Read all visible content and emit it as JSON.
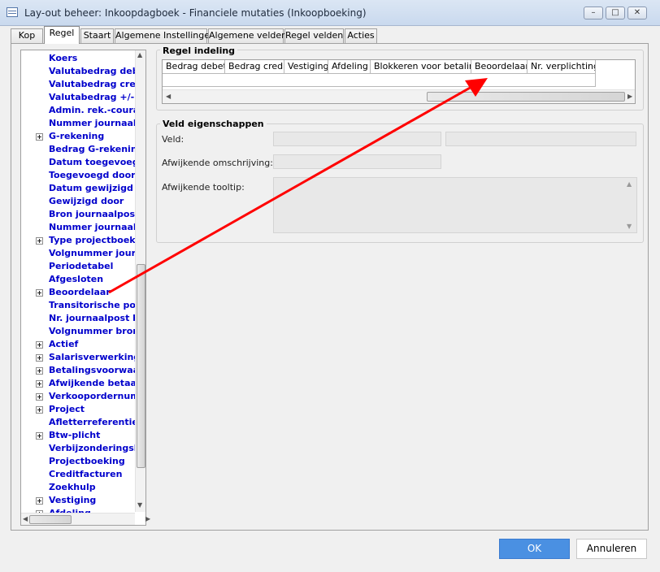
{
  "window": {
    "title": "Lay-out beheer: Inkoopdagboek - Financiele mutaties (Inkoopboeking)"
  },
  "tabs": [
    "Kop",
    "Regel",
    "Staart",
    "Algemene Instellingen",
    "Algemene velden",
    "Regel velden",
    "Acties"
  ],
  "active_tab": "Regel",
  "tree": {
    "items": [
      {
        "label": "Koers",
        "expandable": false
      },
      {
        "label": "Valutabedrag debe",
        "expandable": false
      },
      {
        "label": "Valutabedrag cred",
        "expandable": false
      },
      {
        "label": "Valutabedrag +/-",
        "expandable": false
      },
      {
        "label": "Admin. rek.-courar",
        "expandable": false
      },
      {
        "label": "Nummer journaalpo",
        "expandable": false
      },
      {
        "label": "G-rekening",
        "expandable": true
      },
      {
        "label": "Bedrag G-rekening",
        "expandable": false
      },
      {
        "label": "Datum toegevoegd",
        "expandable": false
      },
      {
        "label": "Toegevoegd door",
        "expandable": false
      },
      {
        "label": "Datum gewijzigd",
        "expandable": false
      },
      {
        "label": "Gewijzigd door",
        "expandable": false
      },
      {
        "label": "Bron journaalpost",
        "expandable": false
      },
      {
        "label": "Nummer journaalpo",
        "expandable": false
      },
      {
        "label": "Type projectboekin",
        "expandable": true
      },
      {
        "label": "Volgnummer journa",
        "expandable": false
      },
      {
        "label": "Periodetabel",
        "expandable": false
      },
      {
        "label": "Afgesloten",
        "expandable": false
      },
      {
        "label": "Beoordelaar",
        "expandable": true
      },
      {
        "label": "Transitorische pos",
        "expandable": false
      },
      {
        "label": "Nr. journaalpost br",
        "expandable": false
      },
      {
        "label": "Volgnummer bron t",
        "expandable": false
      },
      {
        "label": "Actief",
        "expandable": true
      },
      {
        "label": "Salarisverwerkings",
        "expandable": true
      },
      {
        "label": "Betalingsvoorwaar",
        "expandable": true
      },
      {
        "label": "Afwijkende betaalr",
        "expandable": true
      },
      {
        "label": "Verkoopordernumm",
        "expandable": true
      },
      {
        "label": "Project",
        "expandable": true
      },
      {
        "label": "Afletterreferentie",
        "expandable": false
      },
      {
        "label": "Btw-plicht",
        "expandable": true
      },
      {
        "label": "Verbijzonderingsbo",
        "expandable": false
      },
      {
        "label": "Projectboeking",
        "expandable": false
      },
      {
        "label": "Creditfacturen",
        "expandable": false
      },
      {
        "label": "Zoekhulp",
        "expandable": false
      },
      {
        "label": "Vestiging",
        "expandable": true
      },
      {
        "label": "Afdeling",
        "expandable": true
      }
    ]
  },
  "regel_indeling": {
    "title": "Regel indeling",
    "columns": [
      "Bedrag debet",
      "Bedrag credit",
      "Vestiging",
      "Afdeling",
      "Blokkeren voor betaling",
      "Beoordelaar",
      "Nr. verplichting"
    ]
  },
  "veld_eigenschappen": {
    "title": "Veld eigenschappen",
    "veld_label": "Veld:",
    "omschrijving_label": "Afwijkende omschrijving:",
    "tooltip_label": "Afwijkende tooltip:"
  },
  "buttons": {
    "ok": "OK",
    "cancel": "Annuleren"
  },
  "annotation": {
    "color": "#ff0000",
    "from": "Beoordelaar",
    "to": "Beoordelaar"
  }
}
